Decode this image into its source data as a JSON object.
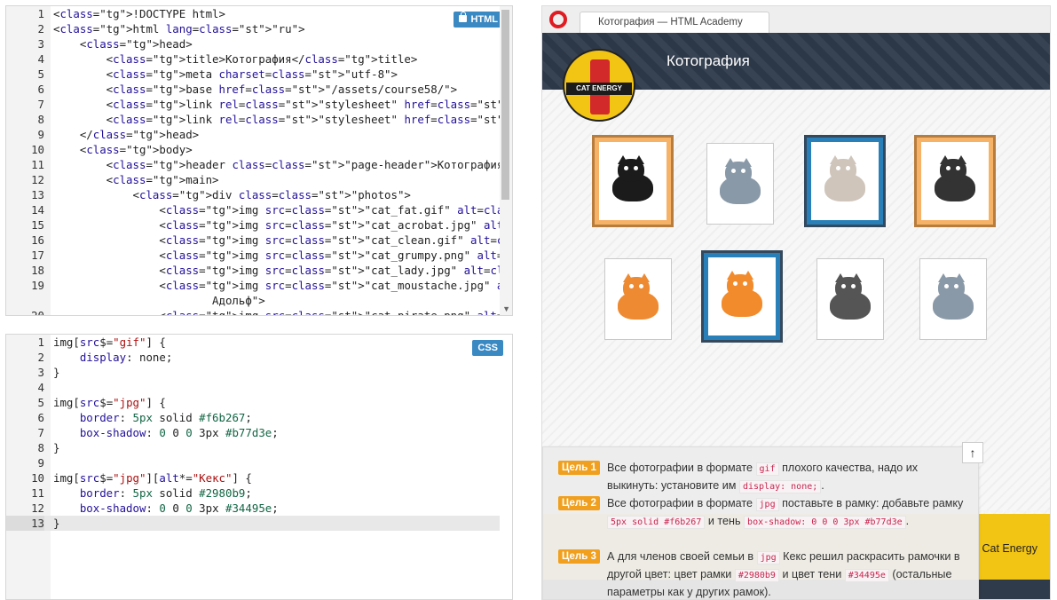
{
  "html_editor": {
    "badge": "HTML",
    "lines": [
      {
        "n": "1",
        "code": "<!DOCTYPE html>"
      },
      {
        "n": "2",
        "code": "<html lang=\"ru\">"
      },
      {
        "n": "3",
        "code": "    <head>"
      },
      {
        "n": "4",
        "code": "        <title>Котография</title>"
      },
      {
        "n": "5",
        "code": "        <meta charset=\"utf-8\">"
      },
      {
        "n": "6",
        "code": "        <base href=\"/assets/course58/\">"
      },
      {
        "n": "7",
        "code": "        <link rel=\"stylesheet\" href=\"style.css\">"
      },
      {
        "n": "8",
        "code": "        <link rel=\"stylesheet\" href=\"cat-boxes.css\">"
      },
      {
        "n": "9",
        "code": "    </head>"
      },
      {
        "n": "10",
        "code": "    <body>"
      },
      {
        "n": "11",
        "code": "        <header class=\"page-header\">Котография</header>"
      },
      {
        "n": "12",
        "code": "        <main>"
      },
      {
        "n": "13",
        "code": "            <div class=\"photos\">"
      },
      {
        "n": "14",
        "code": "                <img src=\"cat_fat.gif\" alt=\"Отец Кекса\">"
      },
      {
        "n": "15",
        "code": "                <img src=\"cat_acrobat.jpg\" alt=\"Черныш\">"
      },
      {
        "n": "16",
        "code": "                <img src=\"cat_clean.gif\" alt=\"Друг Рудольф\">"
      },
      {
        "n": "17",
        "code": "                <img src=\"cat_grumpy.png\" alt=\"Грустный кот\">"
      },
      {
        "n": "18",
        "code": "                <img src=\"cat_lady.jpg\" alt=\"Мама Кекса\">"
      },
      {
        "n": "19",
        "code": "                <img src=\"cat_moustache.jpg\" alt=\"Не Друг"
      },
      {
        "n": "",
        "code": "                        Адольф\">"
      },
      {
        "n": "20",
        "code": "                <img src=\"cat_pirate.png\" alt=\"Брат Кекса"
      }
    ]
  },
  "css_editor": {
    "badge": "CSS",
    "lines": [
      {
        "n": "1",
        "code": "img[src$=\"gif\"] {"
      },
      {
        "n": "2",
        "code": "    display: none;"
      },
      {
        "n": "3",
        "code": "}"
      },
      {
        "n": "4",
        "code": ""
      },
      {
        "n": "5",
        "code": "img[src$=\"jpg\"] {"
      },
      {
        "n": "6",
        "code": "    border: 5px solid #f6b267;"
      },
      {
        "n": "7",
        "code": "    box-shadow: 0 0 0 3px #b77d3e;"
      },
      {
        "n": "8",
        "code": "}"
      },
      {
        "n": "9",
        "code": ""
      },
      {
        "n": "10",
        "code": "img[src$=\"jpg\"][alt*=\"Кекс\"] {"
      },
      {
        "n": "11",
        "code": "    border: 5px solid #2980b9;"
      },
      {
        "n": "12",
        "code": "    box-shadow: 0 0 0 3px #34495e;"
      },
      {
        "n": "13",
        "code": "}"
      }
    ],
    "active_line": "13"
  },
  "browser": {
    "tab_title": "Котография — HTML Academy",
    "page_title": "Котография",
    "logo_text": "CAT ENERGY",
    "footer_brand": "Cat Energy",
    "scroll_up": "↑",
    "photos": [
      {
        "name": "cat-fat",
        "frame": "orange",
        "color": "#1b1b1b"
      },
      {
        "name": "cat-grumpy",
        "frame": "plain",
        "color": "#8a99a8"
      },
      {
        "name": "cat-lady",
        "frame": "blue",
        "color": "#cfc5bb"
      },
      {
        "name": "cat-acrobat",
        "frame": "orange",
        "color": "#333333"
      },
      {
        "name": "cat-pirate",
        "frame": "plain",
        "color": "#ee8a31"
      },
      {
        "name": "cat-moustache",
        "frame": "blue",
        "color": "#f28b2c"
      },
      {
        "name": "cat-clean",
        "frame": "plain",
        "color": "#555555"
      },
      {
        "name": "cat-yarn",
        "frame": "plain",
        "color": "#8a99a8"
      }
    ]
  },
  "goals": [
    {
      "badge": "Цель 1",
      "parts": [
        "Все фотографии в формате ",
        {
          "code": "gif"
        },
        " плохого качества, надо их выкинуть: установите им ",
        {
          "code": "display: none;"
        },
        "."
      ]
    },
    {
      "badge": "Цель 2",
      "parts": [
        "Все фотографии в формате ",
        {
          "code": "jpg"
        },
        " поставьте в рамку: добавьте рамку ",
        {
          "code": "5px solid #f6b267"
        },
        " и тень ",
        {
          "code": "box-shadow: 0 0 0 3px #b77d3e"
        },
        "."
      ]
    },
    {
      "badge": "Цель 3",
      "parts": [
        "А для членов своей семьи в ",
        {
          "code": "jpg"
        },
        " Кекс решил раскрасить рамочки в другой цвет: цвет рамки ",
        {
          "code": "#2980b9"
        },
        " и цвет тени ",
        {
          "code": "#34495e"
        },
        " (остальные параметры как у других рамок)."
      ]
    }
  ],
  "colors": {
    "badge_blue": "#3b89c3",
    "goal_orange": "#f0a01e",
    "header_dark": "#2f3a4b",
    "brand_yellow": "#f2c414"
  }
}
